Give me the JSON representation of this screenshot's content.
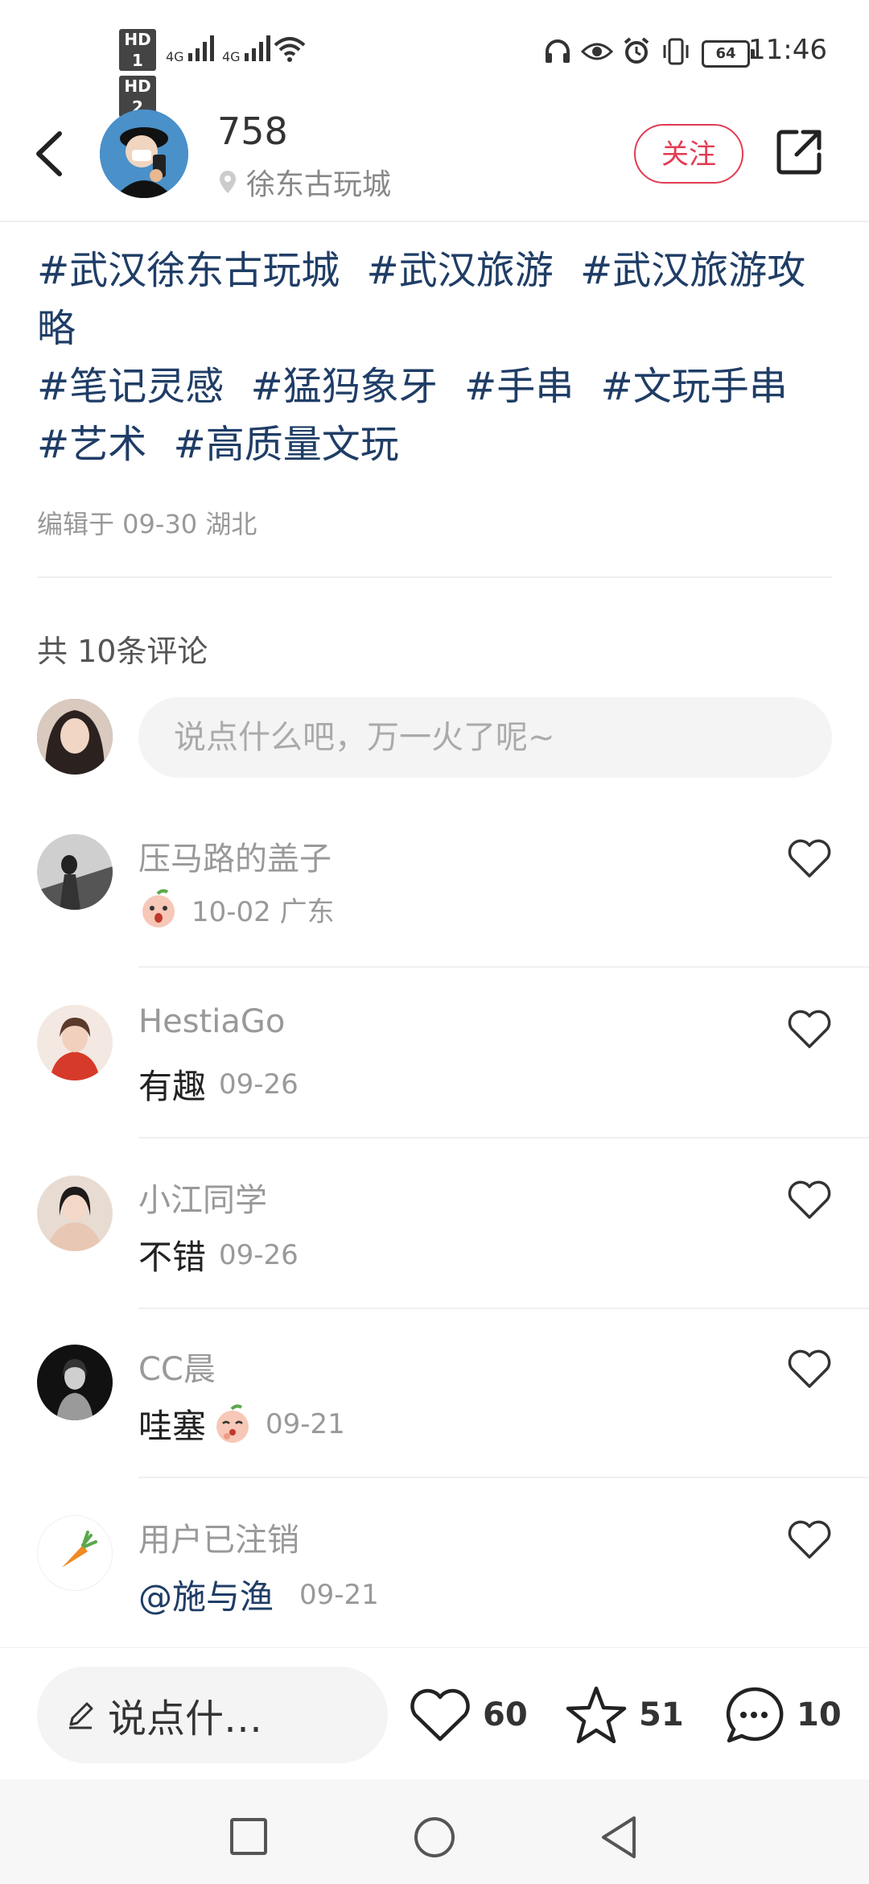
{
  "status_bar": {
    "badges": [
      "HD 1",
      "HD 2"
    ],
    "network": [
      "4G",
      "4G"
    ],
    "battery": "64",
    "time": "11:46"
  },
  "header": {
    "username": "758",
    "location": "徐东古玩城",
    "follow_label": "关注"
  },
  "post": {
    "tags": [
      "#武汉徐东古玩城",
      "#武汉旅游",
      "#武汉旅游攻略",
      "#笔记灵感",
      "#猛犸象牙",
      "#手串",
      "#文玩手串",
      "#艺术",
      "#高质量文玩"
    ],
    "edited": "编辑于 09-30 湖北"
  },
  "comments_section": {
    "count_label": "共 10条评论",
    "input_placeholder": "说点什么吧，万一火了呢~",
    "items": [
      {
        "name": "压马路的盖子",
        "text": "",
        "emoji": "peach-face",
        "date": "10-02 广东"
      },
      {
        "name": "HestiaGo",
        "text": "有趣",
        "emoji": "",
        "date": "09-26"
      },
      {
        "name": "小江同学",
        "text": "不错",
        "emoji": "",
        "date": "09-26"
      },
      {
        "name": "CC晨",
        "text": "哇塞",
        "emoji": "peach-face",
        "date": "09-21"
      },
      {
        "name": "用户已注销",
        "text": "@施与渔",
        "emoji": "",
        "date": "09-21"
      }
    ]
  },
  "bottom_bar": {
    "input_label": "说点什…",
    "likes": "60",
    "favorites": "51",
    "comments": "10"
  },
  "colors": {
    "accent": "#e23c53",
    "tag": "#1f3d66"
  }
}
